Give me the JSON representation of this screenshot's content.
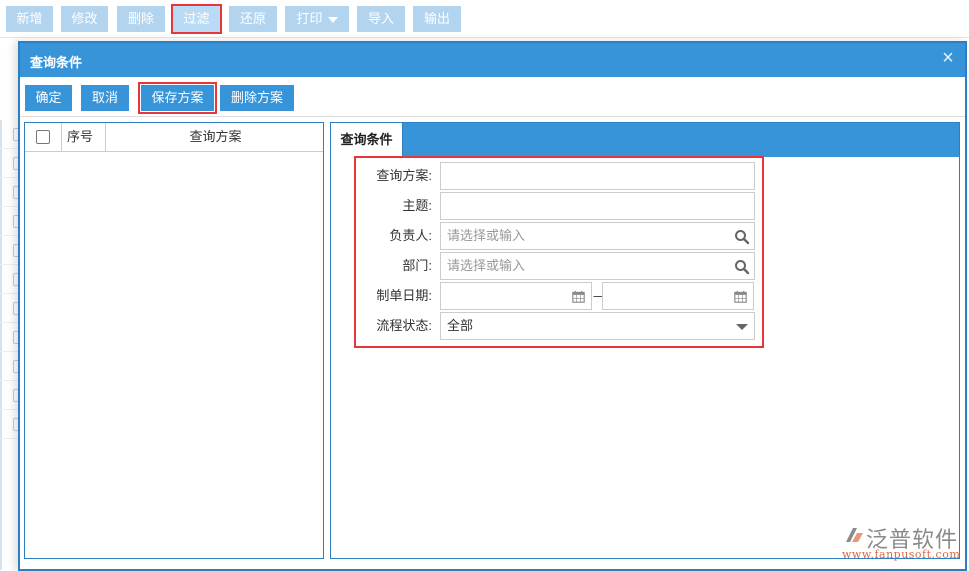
{
  "toolbar": {
    "buttons": [
      {
        "label": "新增"
      },
      {
        "label": "修改"
      },
      {
        "label": "删除"
      },
      {
        "label": "过滤",
        "highlighted": true
      },
      {
        "label": "还原"
      },
      {
        "label": "打印",
        "has_dropdown": true
      },
      {
        "label": "导入"
      },
      {
        "label": "输出"
      }
    ]
  },
  "dialog": {
    "title": "查询条件",
    "close_icon": "close-icon",
    "actions": [
      {
        "label": "确定"
      },
      {
        "label": "取消"
      },
      {
        "label": "保存方案",
        "highlighted": true
      },
      {
        "label": "删除方案"
      }
    ],
    "scheme_table": {
      "columns": [
        "序号",
        "查询方案"
      ],
      "rows": []
    },
    "tab": "查询条件",
    "form": {
      "scheme_label": "查询方案:",
      "scheme_value": "",
      "subject_label": "主题:",
      "subject_value": "",
      "owner_label": "负责人:",
      "owner_placeholder": "请选择或输入",
      "dept_label": "部门:",
      "dept_placeholder": "请选择或输入",
      "date_label": "制单日期:",
      "date_from": "",
      "date_to": "",
      "date_separator": "—",
      "status_label": "流程状态:",
      "status_value": "全部"
    }
  },
  "watermark": {
    "brand": "泛普软件",
    "url": "www.fanpusoft.com"
  },
  "colors": {
    "primary": "#3894d9",
    "toolbar_button": "#b3d4ee",
    "highlight_border": "#e8353a",
    "dialog_border": "#2e7fc1"
  }
}
